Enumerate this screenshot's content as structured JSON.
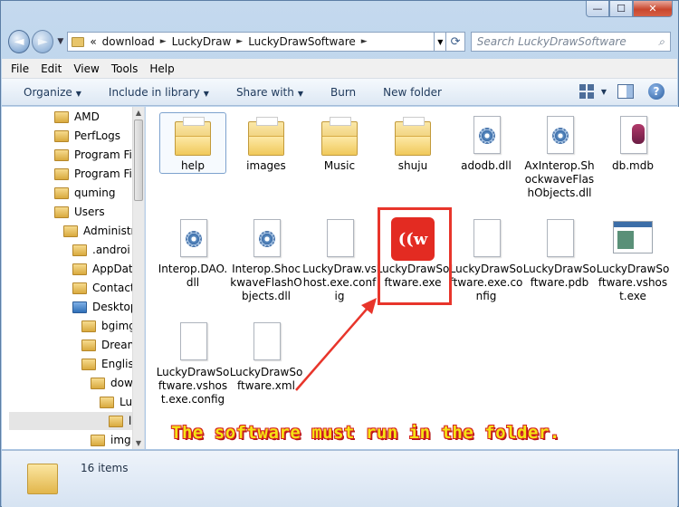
{
  "window": {
    "caption_buttons": {
      "minimize": "—",
      "maximize": "☐",
      "close": "✕"
    }
  },
  "nav": {
    "back_icon": "◄",
    "forward_icon": "►",
    "breadcrumb_prefix": "«",
    "breadcrumbs": [
      "download",
      "LuckyDraw",
      "LuckyDrawSoftware"
    ],
    "search_placeholder": "Search LuckyDrawSoftware",
    "search_icon": "⌕"
  },
  "menu": [
    "File",
    "Edit",
    "View",
    "Tools",
    "Help"
  ],
  "commands": {
    "organize": "Organize",
    "include_in_library": "Include in library",
    "share_with": "Share with",
    "burn": "Burn",
    "new_folder": "New folder",
    "help_glyph": "?"
  },
  "tree": [
    {
      "label": "AMD"
    },
    {
      "label": "PerfLogs"
    },
    {
      "label": "Program Fil"
    },
    {
      "label": "Program Fil"
    },
    {
      "label": "quming"
    },
    {
      "label": "Users"
    },
    {
      "label": "Administr"
    },
    {
      "label": ".androi"
    },
    {
      "label": "AppDat"
    },
    {
      "label": "Contact"
    },
    {
      "label": "Desktop"
    },
    {
      "label": "bgimg"
    },
    {
      "label": "Dream"
    },
    {
      "label": "Englis"
    },
    {
      "label": "dow"
    },
    {
      "label": "Lu"
    },
    {
      "label": "l"
    },
    {
      "label": "img"
    }
  ],
  "files": [
    {
      "name": "help",
      "type": "folder"
    },
    {
      "name": "images",
      "type": "folder"
    },
    {
      "name": "Music",
      "type": "folder"
    },
    {
      "name": "shuju",
      "type": "folder"
    },
    {
      "name": "adodb.dll",
      "type": "dll"
    },
    {
      "name": "AxInterop.ShockwaveFlashObjects.dll",
      "type": "dll"
    },
    {
      "name": "db.mdb",
      "type": "mdb"
    },
    {
      "name": "Interop.DAO.dll",
      "type": "dll"
    },
    {
      "name": "Interop.ShockwaveFlashObjects.dll",
      "type": "dll"
    },
    {
      "name": "LuckyDraw.vshost.exe.config",
      "type": "file"
    },
    {
      "name": "LuckyDrawSoftware.exe",
      "type": "app",
      "glyph": "((w"
    },
    {
      "name": "LuckyDrawSoftware.exe.config",
      "type": "file"
    },
    {
      "name": "LuckyDrawSoftware.pdb",
      "type": "file"
    },
    {
      "name": "LuckyDrawSoftware.vshost.exe",
      "type": "exe"
    },
    {
      "name": "LuckyDrawSoftware.vshost.exe.config",
      "type": "file"
    },
    {
      "name": "LuckyDrawSoftware.xml",
      "type": "file"
    }
  ],
  "annotation": "The software must run in the folder.",
  "status": {
    "count": "16 items"
  },
  "colors": {
    "highlight": "#e8352b",
    "annotation_text": "#f5e214",
    "annotation_outline": "#d42121",
    "app_icon": "#e32b22"
  }
}
